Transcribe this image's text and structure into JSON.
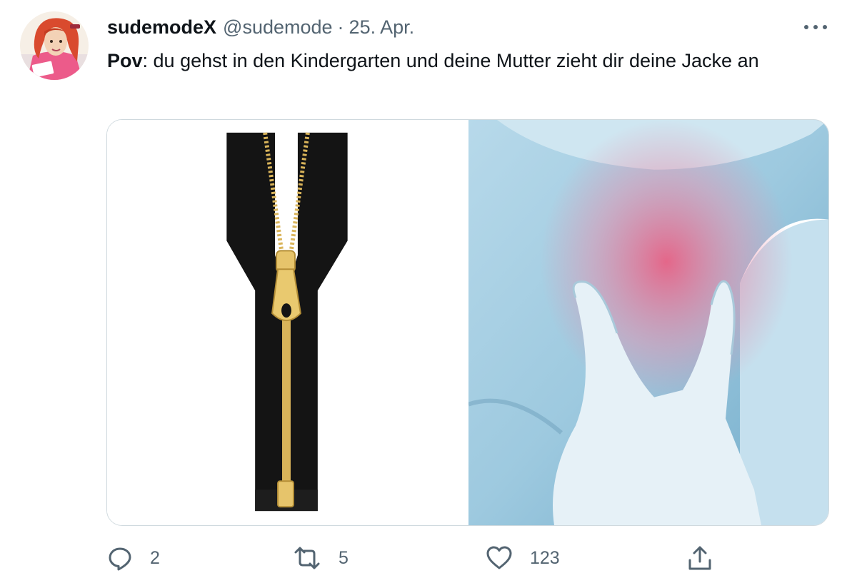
{
  "tweet": {
    "author": {
      "display_name": "sudemodeX",
      "handle": "@sudemode"
    },
    "separator": "·",
    "date": "25. Apr.",
    "text_bold": "Pov",
    "text_rest": ": du gehst in den Kindergarten und deine Mutter zieht dir deine Jacke an",
    "media": [
      {
        "icon": "zipper-image"
      },
      {
        "icon": "sore-throat-image"
      }
    ]
  },
  "actions": {
    "reply": {
      "icon": "reply-icon",
      "count": "2"
    },
    "retweet": {
      "icon": "retweet-icon",
      "count": "5"
    },
    "like": {
      "icon": "heart-icon",
      "count": "123"
    },
    "share": {
      "icon": "share-icon"
    }
  },
  "colors": {
    "text": "#0f1419",
    "secondary": "#536471",
    "border": "#cfd9de"
  }
}
